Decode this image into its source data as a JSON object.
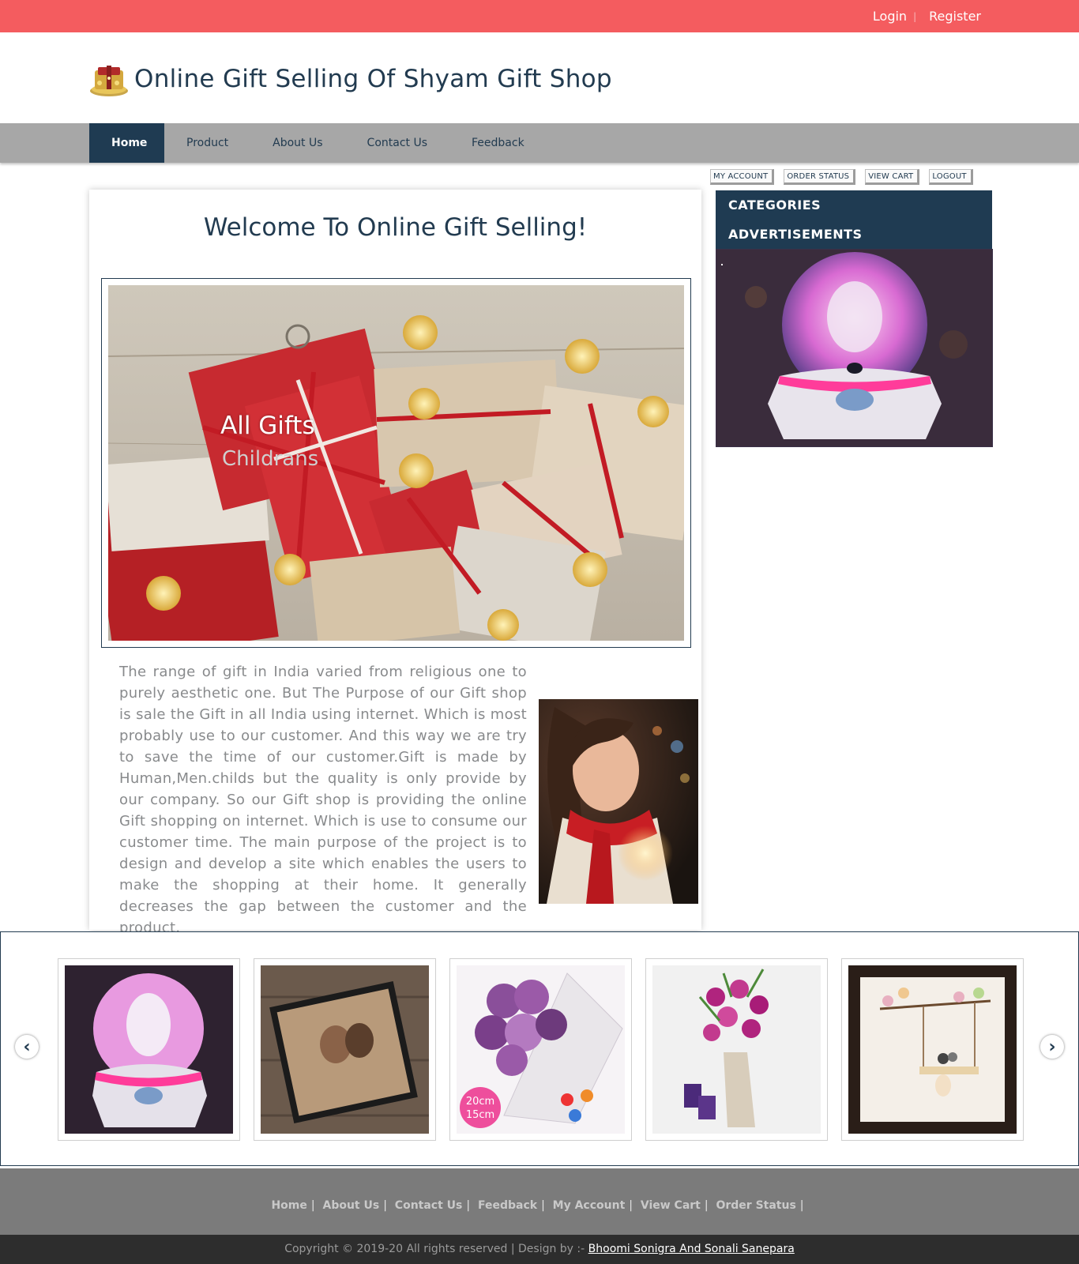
{
  "topbar": {
    "login": "Login",
    "separator": "|",
    "register": "Register"
  },
  "brand": {
    "title": "Online Gift Selling Of Shyam Gift Shop"
  },
  "nav": [
    "Home",
    "Product",
    "About Us",
    "Contact Us",
    "Feedback"
  ],
  "account_buttons": [
    "MY ACCOUNT",
    "ORDER STATUS",
    "VIEW CART",
    "LOGOUT"
  ],
  "main": {
    "heading": "Welcome To Online Gift Selling!",
    "slide_caption_title": "All Gifts",
    "slide_caption_sub": "Childrans",
    "description": "The range of gift in India varied from religious one to purely aesthetic one. But The Purpose of our Gift shop is sale the Gift in all India    using internet. Which is most probably use to our customer. And this way we are try to save the time of our customer.Gift is made by Human,Men.childs but the quality is only provide by our company. So our Gift shop is providing the online Gift shopping on internet. Which is use to consume our customer time. The main purpose of the project is to design and develop a site which enables the users to make the shopping at their home. It generally decreases the gap between the customer and the product."
  },
  "sidebar": {
    "categories": "CATEGORIES",
    "advertisements": "ADVERTISEMENTS"
  },
  "carousel": {
    "prev_icon": "chevron-left-icon",
    "next_icon": "chevron-right-icon",
    "items": [
      "snow-globe",
      "photo-frame",
      "rose-bouquet",
      "orchid-bouquet",
      "swing-art-frame"
    ],
    "bouquet_size_line1": "20cm",
    "bouquet_size_line2": "15cm"
  },
  "footer": {
    "links": [
      "Home",
      "About Us",
      "Contact Us",
      "Feedback",
      "My Account",
      "View Cart",
      "Order Status"
    ],
    "copyright": "Copyright © 2019-20 All rights reserved | Design by :-",
    "designers": "Bhoomi Sonigra And Sonali Sanepara"
  }
}
